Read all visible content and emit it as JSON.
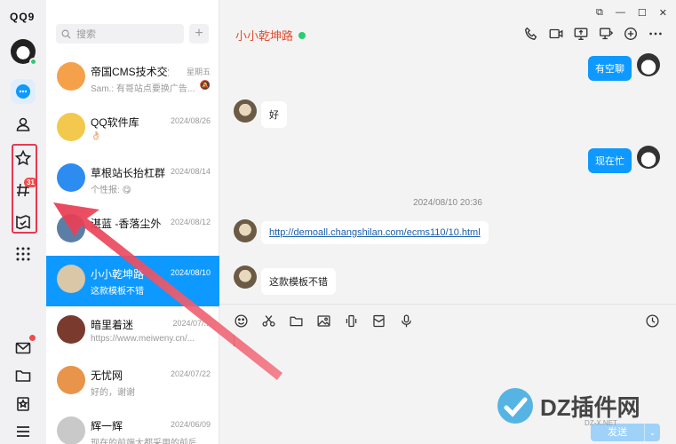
{
  "app": {
    "logo_text": "QQ9"
  },
  "search": {
    "placeholder": "搜索",
    "plus_label": "+"
  },
  "rail": {
    "icons": [
      "message-icon",
      "contacts-icon",
      "star-icon",
      "channel-icon",
      "collection-icon",
      "apps-grid-icon",
      "mail-icon",
      "folder-icon",
      "bookmark-icon",
      "menu-icon"
    ],
    "channel_badge": "31"
  },
  "conversations": [
    {
      "name": "帝国CMS技术交流",
      "date": "星期五",
      "preview": "Sam.: 有哥站点要换广告...",
      "muted": true,
      "avatar_color": "#f5a04b"
    },
    {
      "name": "QQ软件库",
      "date": "2024/08/26",
      "preview": "👌🏻",
      "avatar_color": "#f2c94c"
    },
    {
      "name": "草根站长抬杠群",
      "date": "2024/08/14",
      "preview": "个性报: 😋",
      "avatar_color": "#2d8cf0"
    },
    {
      "name": "湛蓝 -香落尘外",
      "date": "2024/08/12",
      "preview": "",
      "avatar_color": "#5b7ea6"
    },
    {
      "name": "小小乾坤路",
      "date": "2024/08/10",
      "preview": "这款模板不错",
      "selected": true,
      "avatar_color": "#d9c7a8"
    },
    {
      "name": "暗里着迷",
      "date": "2024/07/...",
      "preview": "https://www.meiweny.cn/...",
      "avatar_color": "#7a3b2e"
    },
    {
      "name": "无忧网",
      "date": "2024/07/22",
      "preview": "好的，谢谢",
      "avatar_color": "#e8944a"
    },
    {
      "name": "辉一辉",
      "date": "2024/06/09",
      "preview": "现在的前端大都采用的前后...",
      "avatar_color": "#c9c9c9"
    }
  ],
  "chat": {
    "title": "小小乾坤路",
    "window_controls": [
      "⧉",
      "—",
      "☐",
      "✕"
    ],
    "messages": [
      {
        "side": "right",
        "text": "有空聊"
      },
      {
        "side": "left",
        "text": "好"
      },
      {
        "side": "right",
        "text": "现在忙"
      },
      {
        "side": "left",
        "text": "http://demoall.changshilan.com/ecms110/10.html",
        "link": true
      },
      {
        "side": "left",
        "text": "这款模板不错"
      }
    ],
    "timestamp": "2024/08/10 20:36"
  },
  "composer": {
    "send_label": "发送",
    "send_dropdown": "⌄"
  },
  "watermark": {
    "text": "DZ插件网",
    "sub": "DZ-X.NET"
  },
  "colors": {
    "accent": "#0d99ff",
    "highlight": "#e8384f",
    "title": "#e24b2c"
  }
}
